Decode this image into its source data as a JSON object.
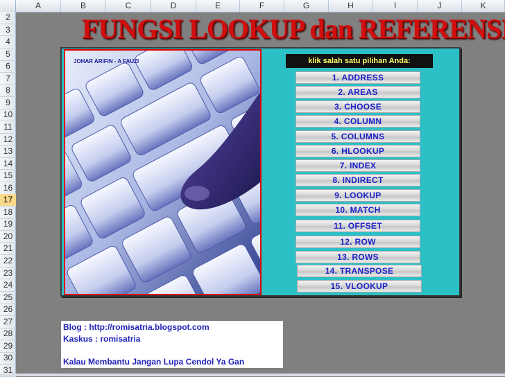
{
  "columns": [
    "A",
    "B",
    "C",
    "D",
    "E",
    "F",
    "G",
    "H",
    "I",
    "J",
    "K"
  ],
  "rows": [
    "2",
    "3",
    "4",
    "5",
    "6",
    "7",
    "8",
    "9",
    "10",
    "11",
    "12",
    "13",
    "14",
    "15",
    "16",
    "17",
    "18",
    "19",
    "20",
    "21",
    "22",
    "23",
    "24",
    "25",
    "26",
    "27",
    "28",
    "29",
    "30",
    "31"
  ],
  "active_row": "17",
  "title": "FUNGSI LOOKUP dan REFERENSI",
  "author": "JOHAR ARIFIN - A FAUZI",
  "prompt": "klik salah satu pilihan Anda:",
  "menu": [
    "1. ADDRESS",
    "2. AREAS",
    "3. CHOOSE",
    "4. COLUMN",
    "5. COLUMNS",
    "6. HLOOKUP",
    "7. INDEX",
    "8. INDIRECT",
    "9. LOOKUP",
    "10. MATCH",
    "11. OFFSET",
    "12. ROW",
    "13. ROWS",
    "14. TRANSPOSE",
    "15. VLOOKUP"
  ],
  "info": {
    "blog": "Blog : http://romisatria.blogspot.com",
    "kaskus": "Kaskus : romisatria",
    "message": "Kalau Membantu Jangan Lupa Cendol Ya Gan"
  },
  "colors": {
    "sheet_bg": "#808080",
    "panel_bg": "#2bc0c6",
    "title": "#d10f0f",
    "menu_text": "#1c22c8",
    "prompt_text": "#ffff66",
    "active_row": "#f9d98a"
  }
}
